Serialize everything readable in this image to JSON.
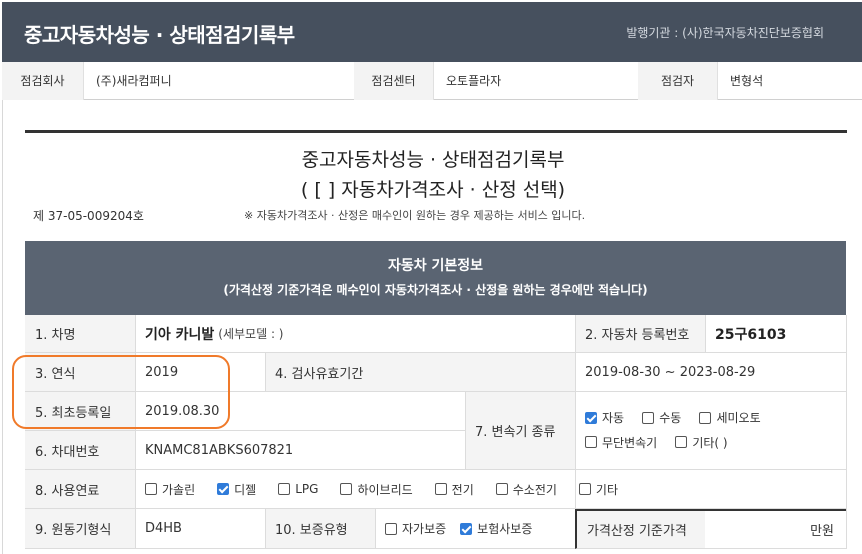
{
  "header": {
    "title": "중고자동차성능 · 상태점검기록부",
    "issuer": "발행기관 : (사)한국자동차진단보증협회"
  },
  "inspection": {
    "company_label": "점검회사",
    "company_value": "(주)새라컴퍼니",
    "center_label": "점검센터",
    "center_value": "오토플라자",
    "inspector_label": "점검자",
    "inspector_value": "변형석"
  },
  "document": {
    "title_line1": "중고자동차성능 · 상태점검기록부",
    "title_line2": "( [      ] 자동차가격조사 · 산정 선택)",
    "number": "제 37-05-009204호",
    "note": "※ 자동차가격조사 · 산정은 매수인이 원하는 경우 제공하는 서비스 입니다."
  },
  "section": {
    "title": "자동차 기본정보",
    "subtitle": "(가격산정 기준가격은 매수인이 자동차가격조사 · 산정을 원하는 경우에만 적습니다)"
  },
  "rows": {
    "car_name_label": "1. 차명",
    "car_name_value": "기아 카니발",
    "car_name_sub": "(세부모델 : )",
    "reg_no_label": "2. 자동차 등록번호",
    "reg_no_value": "25구6103",
    "year_label": "3. 연식",
    "year_value": "2019",
    "valid_label": "4. 검사유효기간",
    "valid_value": "2019-08-30 ~ 2023-08-29",
    "first_reg_label": "5. 최초등록일",
    "first_reg_value": "2019.08.30",
    "vin_label": "6. 차대번호",
    "vin_value": "KNAMC81ABKS607821",
    "transmission_label": "7. 변속기 종류",
    "fuel_label": "8. 사용연료",
    "engine_label": "9. 원동기형식",
    "engine_value": "D4HB",
    "warranty_label": "10. 보증유형",
    "price_label": "가격산정 기준가격",
    "price_unit": "만원"
  },
  "transmission_options": [
    {
      "label": "자동",
      "checked": true
    },
    {
      "label": "수동",
      "checked": false
    },
    {
      "label": "세미오토",
      "checked": false
    },
    {
      "label": "무단변속기",
      "checked": false
    },
    {
      "label": "기타( )",
      "checked": false
    }
  ],
  "fuel_options": [
    {
      "label": "가솔린",
      "checked": false
    },
    {
      "label": "디젤",
      "checked": true
    },
    {
      "label": "LPG",
      "checked": false
    },
    {
      "label": "하이브리드",
      "checked": false
    },
    {
      "label": "전기",
      "checked": false
    },
    {
      "label": "수소전기",
      "checked": false
    },
    {
      "label": "기타",
      "checked": false
    }
  ],
  "warranty_options": [
    {
      "label": "자가보증",
      "checked": false
    },
    {
      "label": "보험사보증",
      "checked": true
    }
  ],
  "colors": {
    "header_bg": "#46505e",
    "banner_bg": "#5a6472",
    "highlight": "#f07a2a",
    "checkbox_on": "#2f7bd9"
  }
}
